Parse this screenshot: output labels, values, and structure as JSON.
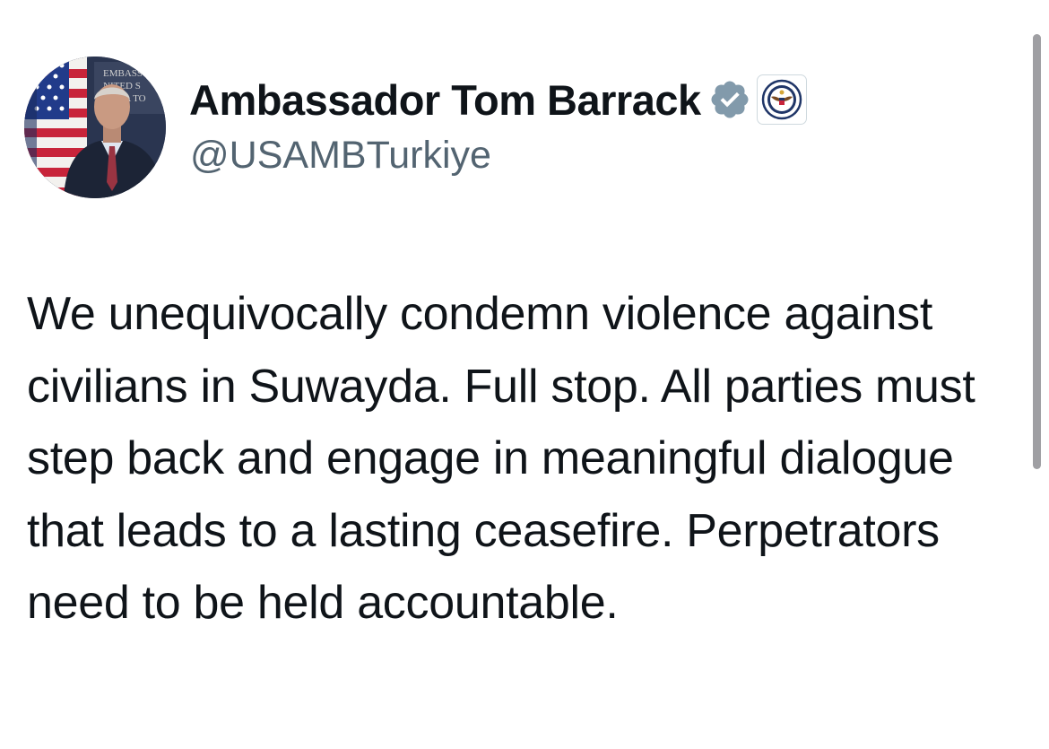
{
  "post": {
    "author": {
      "display_name": "Ambassador Tom Barrack",
      "handle": "@USAMBTurkiye",
      "verified_color": "#829aab",
      "avatar_sign_lines": [
        "EMBASS",
        "NITED S",
        "KARA TO"
      ]
    },
    "text": "We unequivocally condemn violence against civilians in Suwayda. Full stop. All parties must step back and engage in meaningful dialogue that leads to a lasting ceasefire. Perpetrators need to be held accountable."
  },
  "icons": {
    "verified_badge": "verified-badge-icon",
    "affiliation_badge": "state-department-seal-icon"
  }
}
